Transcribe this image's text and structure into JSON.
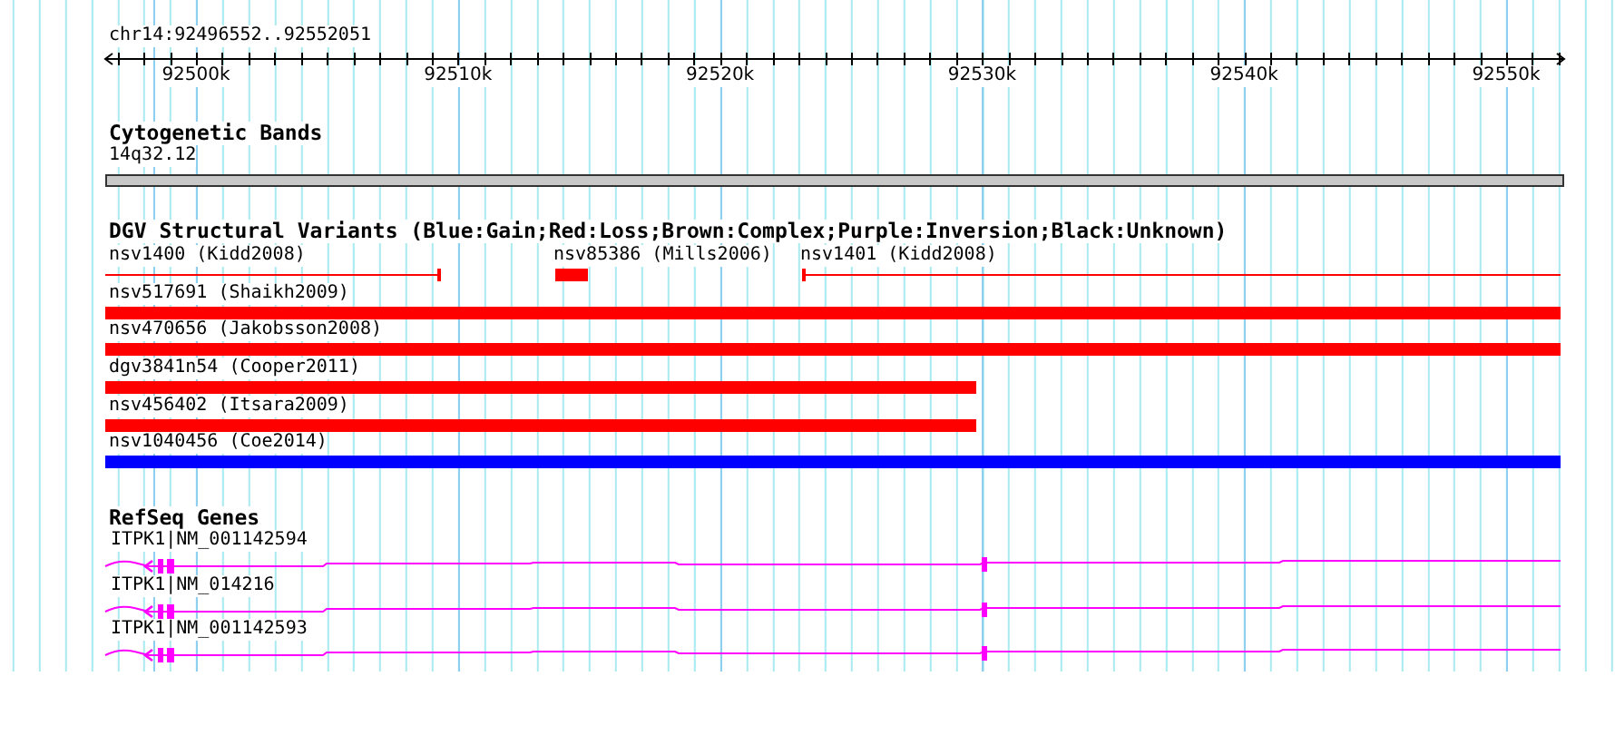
{
  "locus": "chr14:92496552..92552051",
  "ruler_ticks": [
    "92500k",
    "92510k",
    "92520k",
    "92530k",
    "92540k",
    "92550k"
  ],
  "tracks": [
    {
      "kind": "cytoband",
      "title": "Cytogenetic Bands",
      "band": "14q32.12"
    },
    {
      "kind": "variants",
      "title": "DGV Structural Variants (Blue:Gain;Red:Loss;Brown:Complex;Purple:Inversion;Black:Unknown)",
      "rows": [
        [
          {
            "label": "nsv1400 (Kidd2008)",
            "kind": "thin",
            "color": "#ff0000"
          },
          {
            "label": "nsv85386 (Mills2006)",
            "kind": "bar",
            "color": "#ff0000"
          },
          {
            "label": "nsv1401 (Kidd2008)",
            "kind": "thin",
            "color": "#ff0000"
          }
        ],
        [
          {
            "label": "nsv517691 (Shaikh2009)",
            "kind": "bar",
            "color": "#ff0000"
          }
        ],
        [
          {
            "label": "nsv470656 (Jakobsson2008)",
            "kind": "bar",
            "color": "#ff0000"
          }
        ],
        [
          {
            "label": "dgv3841n54 (Cooper2011)",
            "kind": "bar",
            "color": "#ff0000"
          }
        ],
        [
          {
            "label": "nsv456402 (Itsara2009)",
            "kind": "bar",
            "color": "#ff0000"
          }
        ],
        [
          {
            "label": "nsv1040456 (Coe2014)",
            "kind": "bar",
            "color": "#0000ff"
          }
        ]
      ]
    },
    {
      "kind": "genes",
      "title": "RefSeq Genes",
      "genes": [
        {
          "label": "ITPK1|NM_001142594"
        },
        {
          "label": "ITPK1|NM_014216"
        },
        {
          "label": "ITPK1|NM_001142593"
        }
      ]
    }
  ]
}
